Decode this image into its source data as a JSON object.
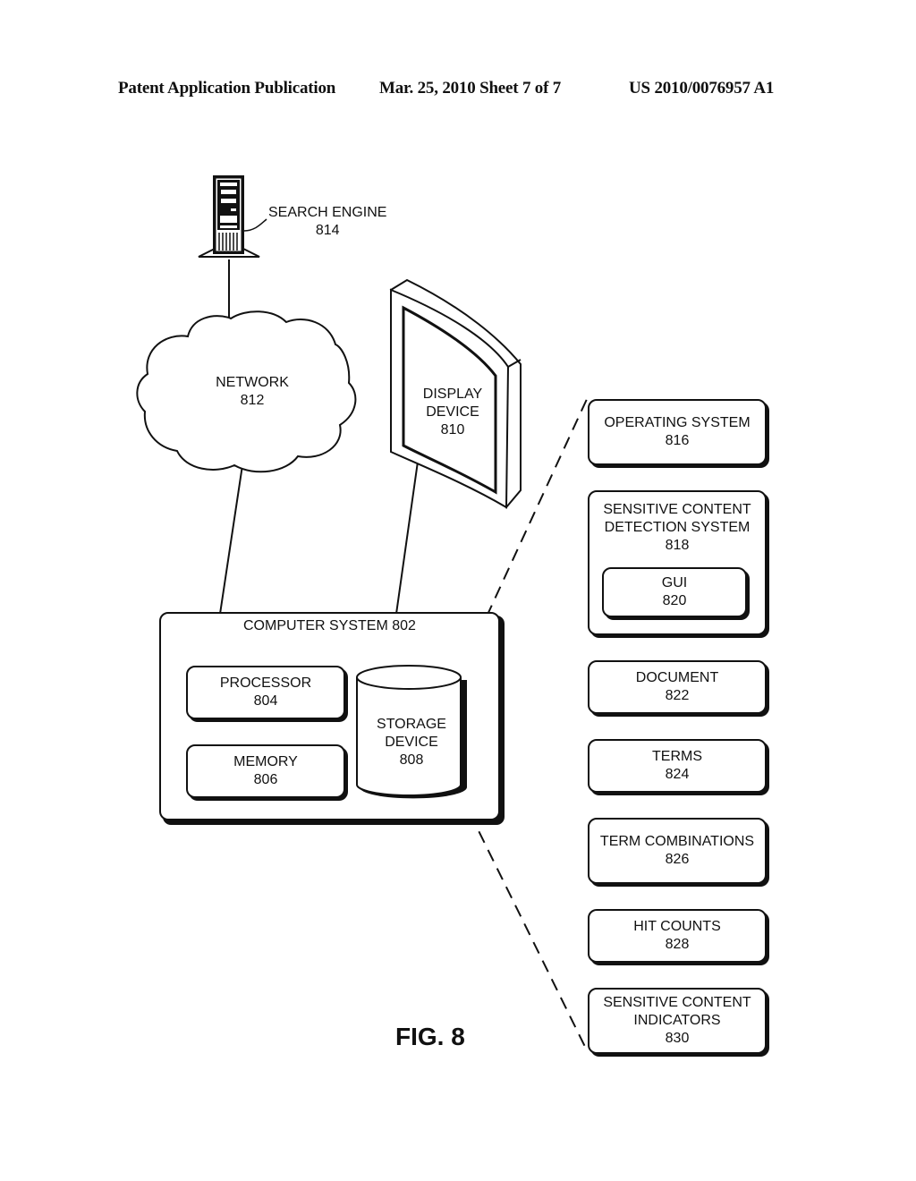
{
  "header": {
    "left": "Patent Application Publication",
    "center": "Mar. 25, 2010  Sheet 7 of 7",
    "right": "US 2010/0076957 A1"
  },
  "nodes": {
    "search_engine": {
      "name": "SEARCH ENGINE",
      "ref": "814",
      "icon": "server-tower-icon"
    },
    "network": {
      "name": "NETWORK",
      "ref": "812",
      "icon": "cloud-icon"
    },
    "display_device": {
      "line1": "DISPLAY",
      "line2": "DEVICE",
      "ref": "810",
      "icon": "monitor-icon"
    },
    "computer_system": {
      "title": "COMPUTER SYSTEM 802"
    },
    "processor": {
      "name": "PROCESSOR",
      "ref": "804"
    },
    "memory": {
      "name": "MEMORY",
      "ref": "806"
    },
    "storage_device": {
      "line1": "STORAGE",
      "line2": "DEVICE",
      "ref": "808",
      "icon": "database-cylinder-icon"
    }
  },
  "storage_contents": [
    {
      "line1": "OPERATING SYSTEM",
      "line2": "",
      "ref": "816"
    },
    {
      "line1": "SENSITIVE CONTENT",
      "line2": "DETECTION SYSTEM",
      "ref": "818",
      "child": {
        "name": "GUI",
        "ref": "820"
      }
    },
    {
      "line1": "DOCUMENT",
      "line2": "",
      "ref": "822"
    },
    {
      "line1": "TERMS",
      "line2": "",
      "ref": "824"
    },
    {
      "line1": "TERM COMBINATIONS",
      "line2": "",
      "ref": "826"
    },
    {
      "line1": "HIT COUNTS",
      "line2": "",
      "ref": "828"
    },
    {
      "line1": "SENSITIVE CONTENT",
      "line2": "INDICATORS",
      "ref": "830"
    }
  ],
  "figure_label": "FIG. 8"
}
